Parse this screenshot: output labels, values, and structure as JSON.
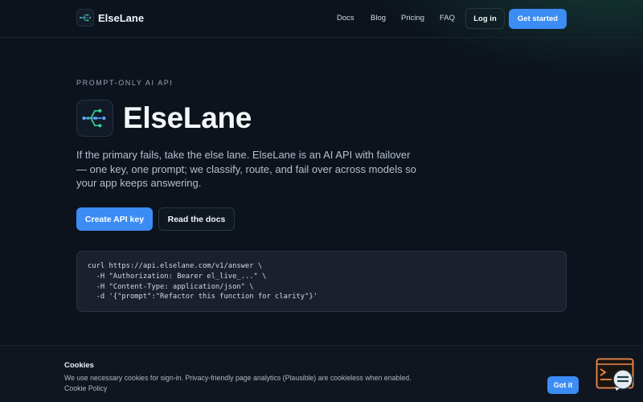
{
  "header": {
    "brand": "ElseLane",
    "nav": [
      {
        "label": "Docs"
      },
      {
        "label": "Blog"
      },
      {
        "label": "Pricing"
      },
      {
        "label": "FAQ"
      }
    ],
    "login_label": "Log in",
    "get_started_label": "Get started"
  },
  "hero": {
    "eyebrow": "PROMPT-ONLY AI API",
    "title": "ElseLane",
    "description": "If the primary fails, take the else lane. ElseLane is an AI API with failover — one key, one prompt; we classify, route, and fail over across models so your app keeps answering.",
    "create_key_label": "Create API key",
    "read_docs_label": "Read the docs"
  },
  "code": {
    "lines": [
      "curl https://api.elselane.com/v1/answer \\",
      "  -H \"Authorization: Bearer el_live_...\" \\",
      "  -H \"Content-Type: application/json\" \\",
      "  -d '{\"prompt\":\"Refactor this function for clarity\"}'"
    ]
  },
  "cookie": {
    "title": "Cookies",
    "text": "We use necessary cookies for sign-in. Privacy-friendly page analytics (Plausible) are cookieless when enabled.",
    "link_label": "Cookie Policy",
    "got_it_label": "Got it"
  },
  "icons": {
    "brand_logo": "route-fork-icon",
    "widget": "terminal-chat-icon"
  },
  "colors": {
    "accent": "#3b8cf5",
    "background": "#0c131d",
    "logo_green": "#34d399",
    "logo_blue": "#60a5fa"
  }
}
